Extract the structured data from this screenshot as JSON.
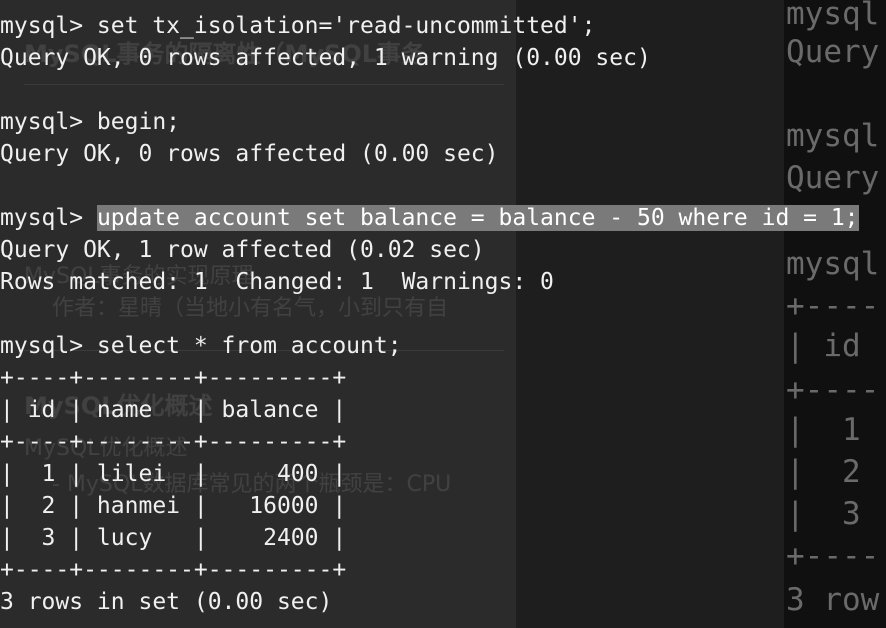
{
  "background_page": {
    "title": "MySQL事务的隔离性（MySQL事务",
    "article_title": "MySQL事务的实现原理",
    "author": "作者：星晴（当地小有名气，小到只有自",
    "section_heading": "MySQL优化概述",
    "subheading": "MySQL优化概述",
    "snippet": "- MySQL数据库常见的两个瓶颈是：CPU"
  },
  "terminal": {
    "lines": {
      "l1": "mysql> set tx_isolation='read-uncommitted';",
      "l2": "Query OK, 0 rows affected, 1 warning (0.00 sec)",
      "l3": "",
      "l4": "mysql> begin;",
      "l5": "Query OK, 0 rows affected (0.00 sec)",
      "l6": "",
      "l8": "Query OK, 1 row affected (0.02 sec)",
      "l9": "Rows matched: 1  Changed: 1  Warnings: 0",
      "l10": "",
      "l11": "mysql> select * from account;",
      "l12": "+----+--------+---------+",
      "l13": "| id | name   | balance |",
      "l14": "+----+--------+---------+",
      "l15": "|  1 | lilei  |     400 |",
      "l16": "|  2 | hanmei |   16000 |",
      "l17": "|  3 | lucy   |    2400 |",
      "l18": "+----+--------+---------+",
      "l19": "3 rows in set (0.00 sec)"
    },
    "l7_prompt": "mysql> ",
    "l7_selected": "update account set balance = balance - 50 where id = 1;"
  },
  "right_terminal": {
    "r1": "mysql",
    "r2": "Query",
    "r3": "",
    "r4": "mysql",
    "r5": "Query",
    "r6": "",
    "r7": "mysql",
    "r8": "+----",
    "r9": "| id",
    "r10": "+----",
    "r11": "|  1",
    "r12": "|  2",
    "r13": "|  3",
    "r14": "+----",
    "r15": "3 row"
  },
  "colors": {
    "terminal_bg": "#1e1e1e",
    "text": "#f0f0f0",
    "selection": "#7a7a7a"
  }
}
